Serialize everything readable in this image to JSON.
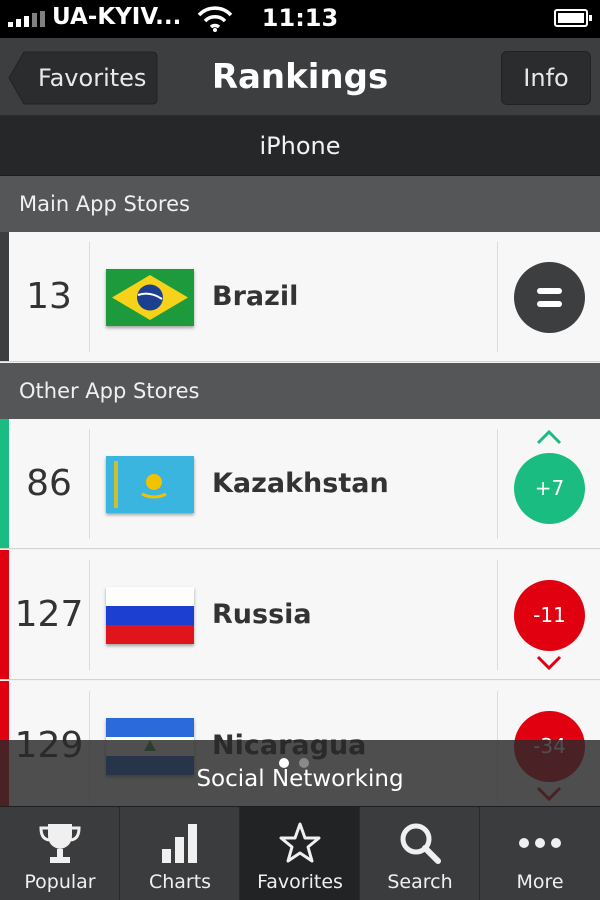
{
  "status_bar": {
    "carrier": "UA-KYIV...",
    "time": "11:13"
  },
  "nav": {
    "back_label": "Favorites",
    "title": "Rankings",
    "info_label": "Info"
  },
  "segment": {
    "label": "iPhone"
  },
  "sections": [
    {
      "header": "Main App Stores"
    },
    {
      "header": "Other App Stores"
    }
  ],
  "rows": [
    {
      "rank": "13",
      "country": "Brazil",
      "change": "",
      "trend": "same",
      "color": "#3c3e40"
    },
    {
      "rank": "86",
      "country": "Kazakhstan",
      "change": "+7",
      "trend": "up",
      "color": "#1bbc82"
    },
    {
      "rank": "127",
      "country": "Russia",
      "change": "-11",
      "trend": "down",
      "color": "#e1000f"
    },
    {
      "rank": "129",
      "country": "Nicaragua",
      "change": "-34",
      "trend": "down",
      "color": "#e1000f"
    }
  ],
  "overlay": {
    "label": "Social Networking",
    "page_dots": 2,
    "active_dot": 0
  },
  "tabs": [
    {
      "label": "Popular",
      "icon": "trophy-icon"
    },
    {
      "label": "Charts",
      "icon": "bar-chart-icon"
    },
    {
      "label": "Favorites",
      "icon": "star-icon",
      "active": true
    },
    {
      "label": "Search",
      "icon": "search-icon"
    },
    {
      "label": "More",
      "icon": "more-dots-icon"
    }
  ],
  "colors": {
    "up": "#1bbc82",
    "down": "#e1000f",
    "same": "#3c3e40"
  }
}
